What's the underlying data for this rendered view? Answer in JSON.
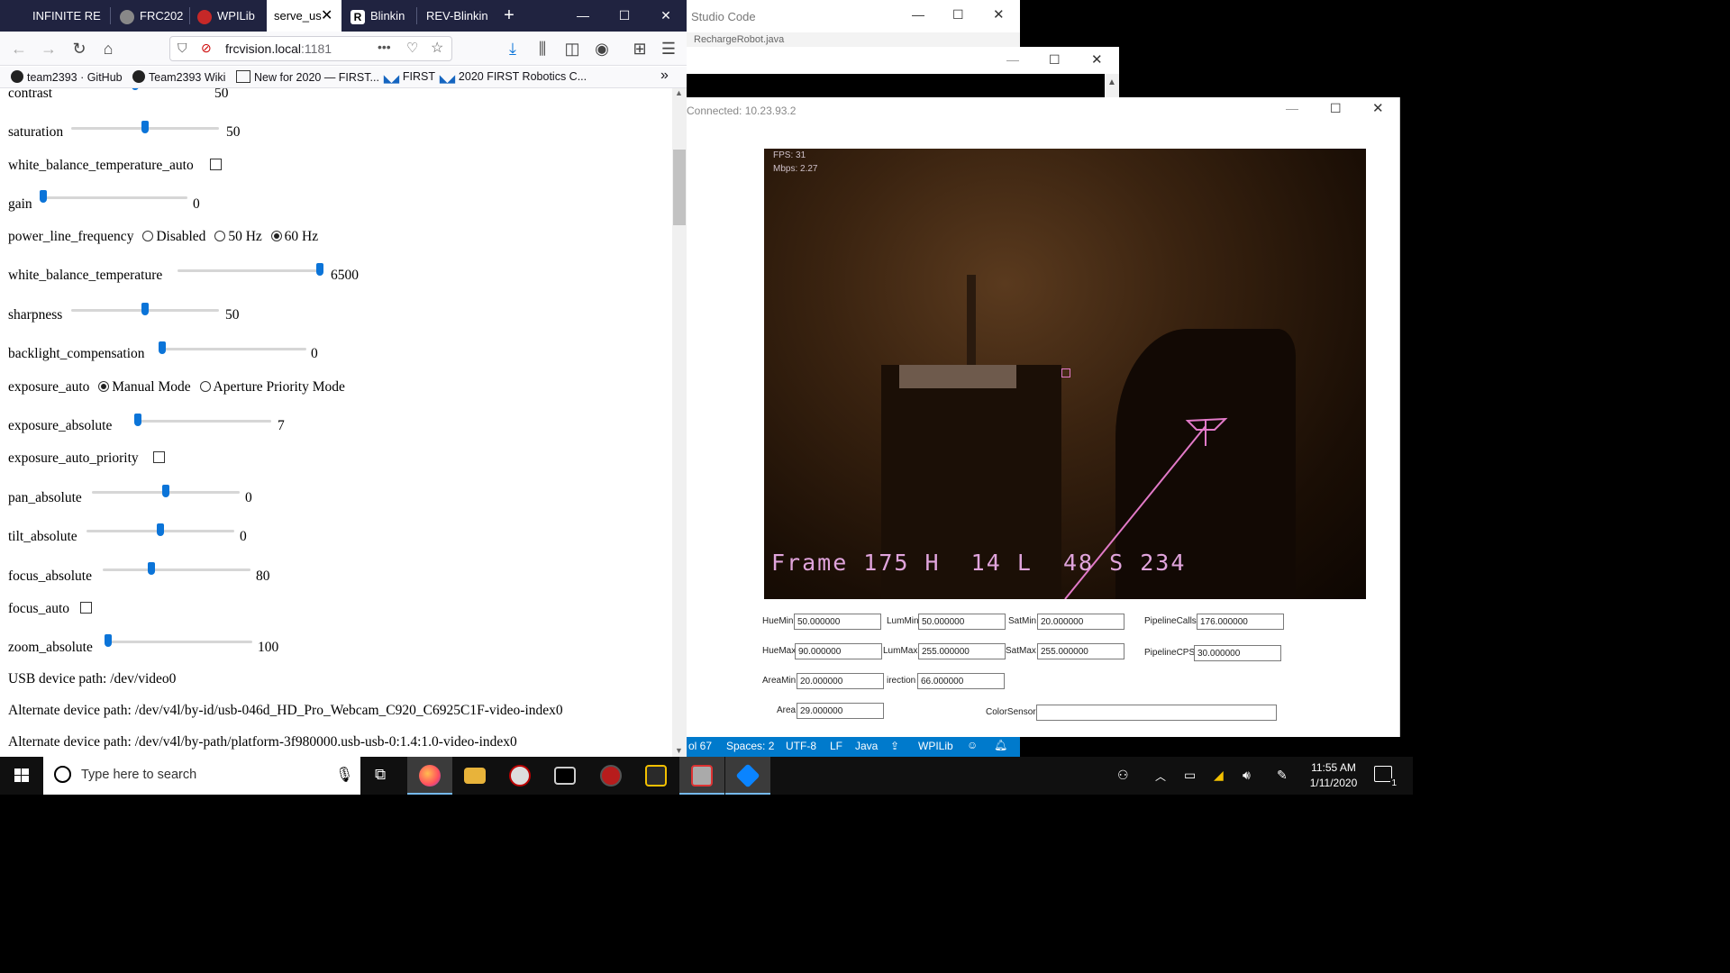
{
  "firefox": {
    "tabs": [
      {
        "label": "INFINITE RE",
        "active": false
      },
      {
        "label": "FRC202",
        "active": false
      },
      {
        "label": "WPILib",
        "active": false
      },
      {
        "label": "serve_us",
        "active": true
      },
      {
        "label": "Blinkin",
        "active": false
      },
      {
        "label": "REV-Blinkin",
        "active": false
      }
    ],
    "url_host": "frcvision.local",
    "url_port": ":1181",
    "bookmarks": [
      "team2393 · GitHub",
      "Team2393 Wiki",
      "New for 2020 — FIRST...",
      "FIRST",
      "2020 FIRST Robotics C..."
    ]
  },
  "settings": {
    "contrast": {
      "label": "contrast",
      "value": "50",
      "level": 0.5
    },
    "saturation": {
      "label": "saturation",
      "value": "50",
      "level": 0.5
    },
    "wb_auto": {
      "label": "white_balance_temperature_auto",
      "checked": false
    },
    "gain": {
      "label": "gain",
      "value": "0",
      "level": 0.0
    },
    "power_line": {
      "label": "power_line_frequency",
      "options": [
        "Disabled",
        "50 Hz",
        "60 Hz"
      ],
      "selected": "60 Hz"
    },
    "wb_temp": {
      "label": "white_balance_temperature",
      "value": "6500",
      "level": 1.0
    },
    "sharpness": {
      "label": "sharpness",
      "value": "50",
      "level": 0.5
    },
    "backlight": {
      "label": "backlight_compensation",
      "value": "0",
      "level": 0.0
    },
    "exposure_auto": {
      "label": "exposure_auto",
      "options": [
        "Manual Mode",
        "Aperture Priority Mode"
      ],
      "selected": "Manual Mode"
    },
    "exposure_absolute": {
      "label": "exposure_absolute",
      "value": "7",
      "level": 0.0
    },
    "exposure_auto_priority": {
      "label": "exposure_auto_priority",
      "checked": false
    },
    "pan": {
      "label": "pan_absolute",
      "value": "0",
      "level": 0.5
    },
    "tilt": {
      "label": "tilt_absolute",
      "value": "0",
      "level": 0.5
    },
    "focus_absolute": {
      "label": "focus_absolute",
      "value": "80",
      "level": 0.32
    },
    "focus_auto": {
      "label": "focus_auto",
      "checked": false
    },
    "zoom": {
      "label": "zoom_absolute",
      "value": "100",
      "level": 0.0
    },
    "usb_path": "USB device path: /dev/video0",
    "alt_path_1": "Alternate device path: /dev/v4l/by-id/usb-046d_HD_Pro_Webcam_C920_C6925C1F-video-index0",
    "alt_path_2": "Alternate device path: /dev/v4l/by-path/platform-3f980000.usb-usb-0:1.4:1.0-video-index0"
  },
  "vscode": {
    "title": "Studio Code",
    "tab_text": "RechargeRobot.java",
    "status": [
      "ol 67",
      "Spaces: 2",
      "UTF-8",
      "LF",
      "Java",
      "WPILib"
    ]
  },
  "viewer": {
    "title": "Connected: 10.23.93.2",
    "fps": "FPS: 31",
    "mbps": "Mbps: 2.27",
    "hud": "Frame 175 H  14 L  48 S 234",
    "fields": {
      "huemin": {
        "label": "HueMin",
        "value": "50.000000"
      },
      "lummin": {
        "label": "LumMin",
        "value": "50.000000"
      },
      "satmin": {
        "label": "SatMin",
        "value": "20.000000"
      },
      "pipelinecalls": {
        "label": "PipelineCalls",
        "value": "176.000000"
      },
      "huemax": {
        "label": "HueMax",
        "value": "90.000000"
      },
      "lummax": {
        "label": "LumMax",
        "value": "255.000000"
      },
      "satmax": {
        "label": "SatMax",
        "value": "255.000000"
      },
      "pipelinecps": {
        "label": "PipelineCPS",
        "value": "30.000000"
      },
      "areamin": {
        "label": "AreaMin",
        "value": "20.000000"
      },
      "direction": {
        "label": "irection",
        "value": "66.000000"
      },
      "area": {
        "label": "Area",
        "value": "29.000000"
      },
      "colorsensor": {
        "label": "ColorSensor",
        "value": ""
      }
    }
  },
  "taskbar": {
    "search_placeholder": "Type here to search",
    "time": "11:55 AM",
    "date": "1/11/2020",
    "notifications": "1"
  },
  "colors": {
    "firefox_tabbar": "#202340",
    "slider_accent": "#0b74d8",
    "vscode_status": "#007acc",
    "hud_text": "#e0a4dc"
  }
}
